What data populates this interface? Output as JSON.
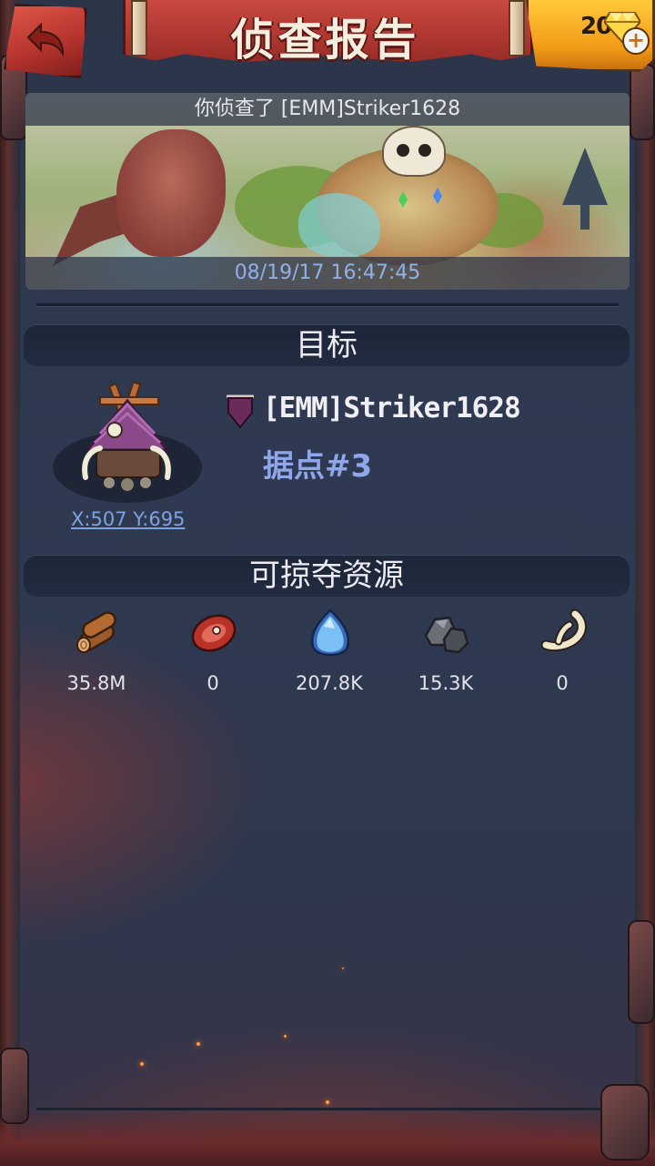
{
  "header": {
    "title": "侦查报告",
    "gem_count": "20"
  },
  "scout": {
    "caption": "你侦查了 [EMM]Striker1628",
    "timestamp": "08/19/17 16:47:45"
  },
  "target_section": {
    "title": "目标",
    "player_name": "[EMM]Striker1628",
    "target_type": "据点#3",
    "coordinates": "X:507 Y:695"
  },
  "loot_section": {
    "title": "可掠夺资源",
    "resources": [
      {
        "icon": "wood-icon",
        "value": "35.8M"
      },
      {
        "icon": "meat-icon",
        "value": "0"
      },
      {
        "icon": "crystal-icon",
        "value": "207.8K"
      },
      {
        "icon": "stone-icon",
        "value": "15.3K"
      },
      {
        "icon": "bone-icon",
        "value": "0"
      }
    ]
  },
  "colors": {
    "accent_red": "#b2322c",
    "gem_gold": "#f29a18",
    "link_blue": "#7ea2dd",
    "panel_dark": "#1d2538"
  }
}
